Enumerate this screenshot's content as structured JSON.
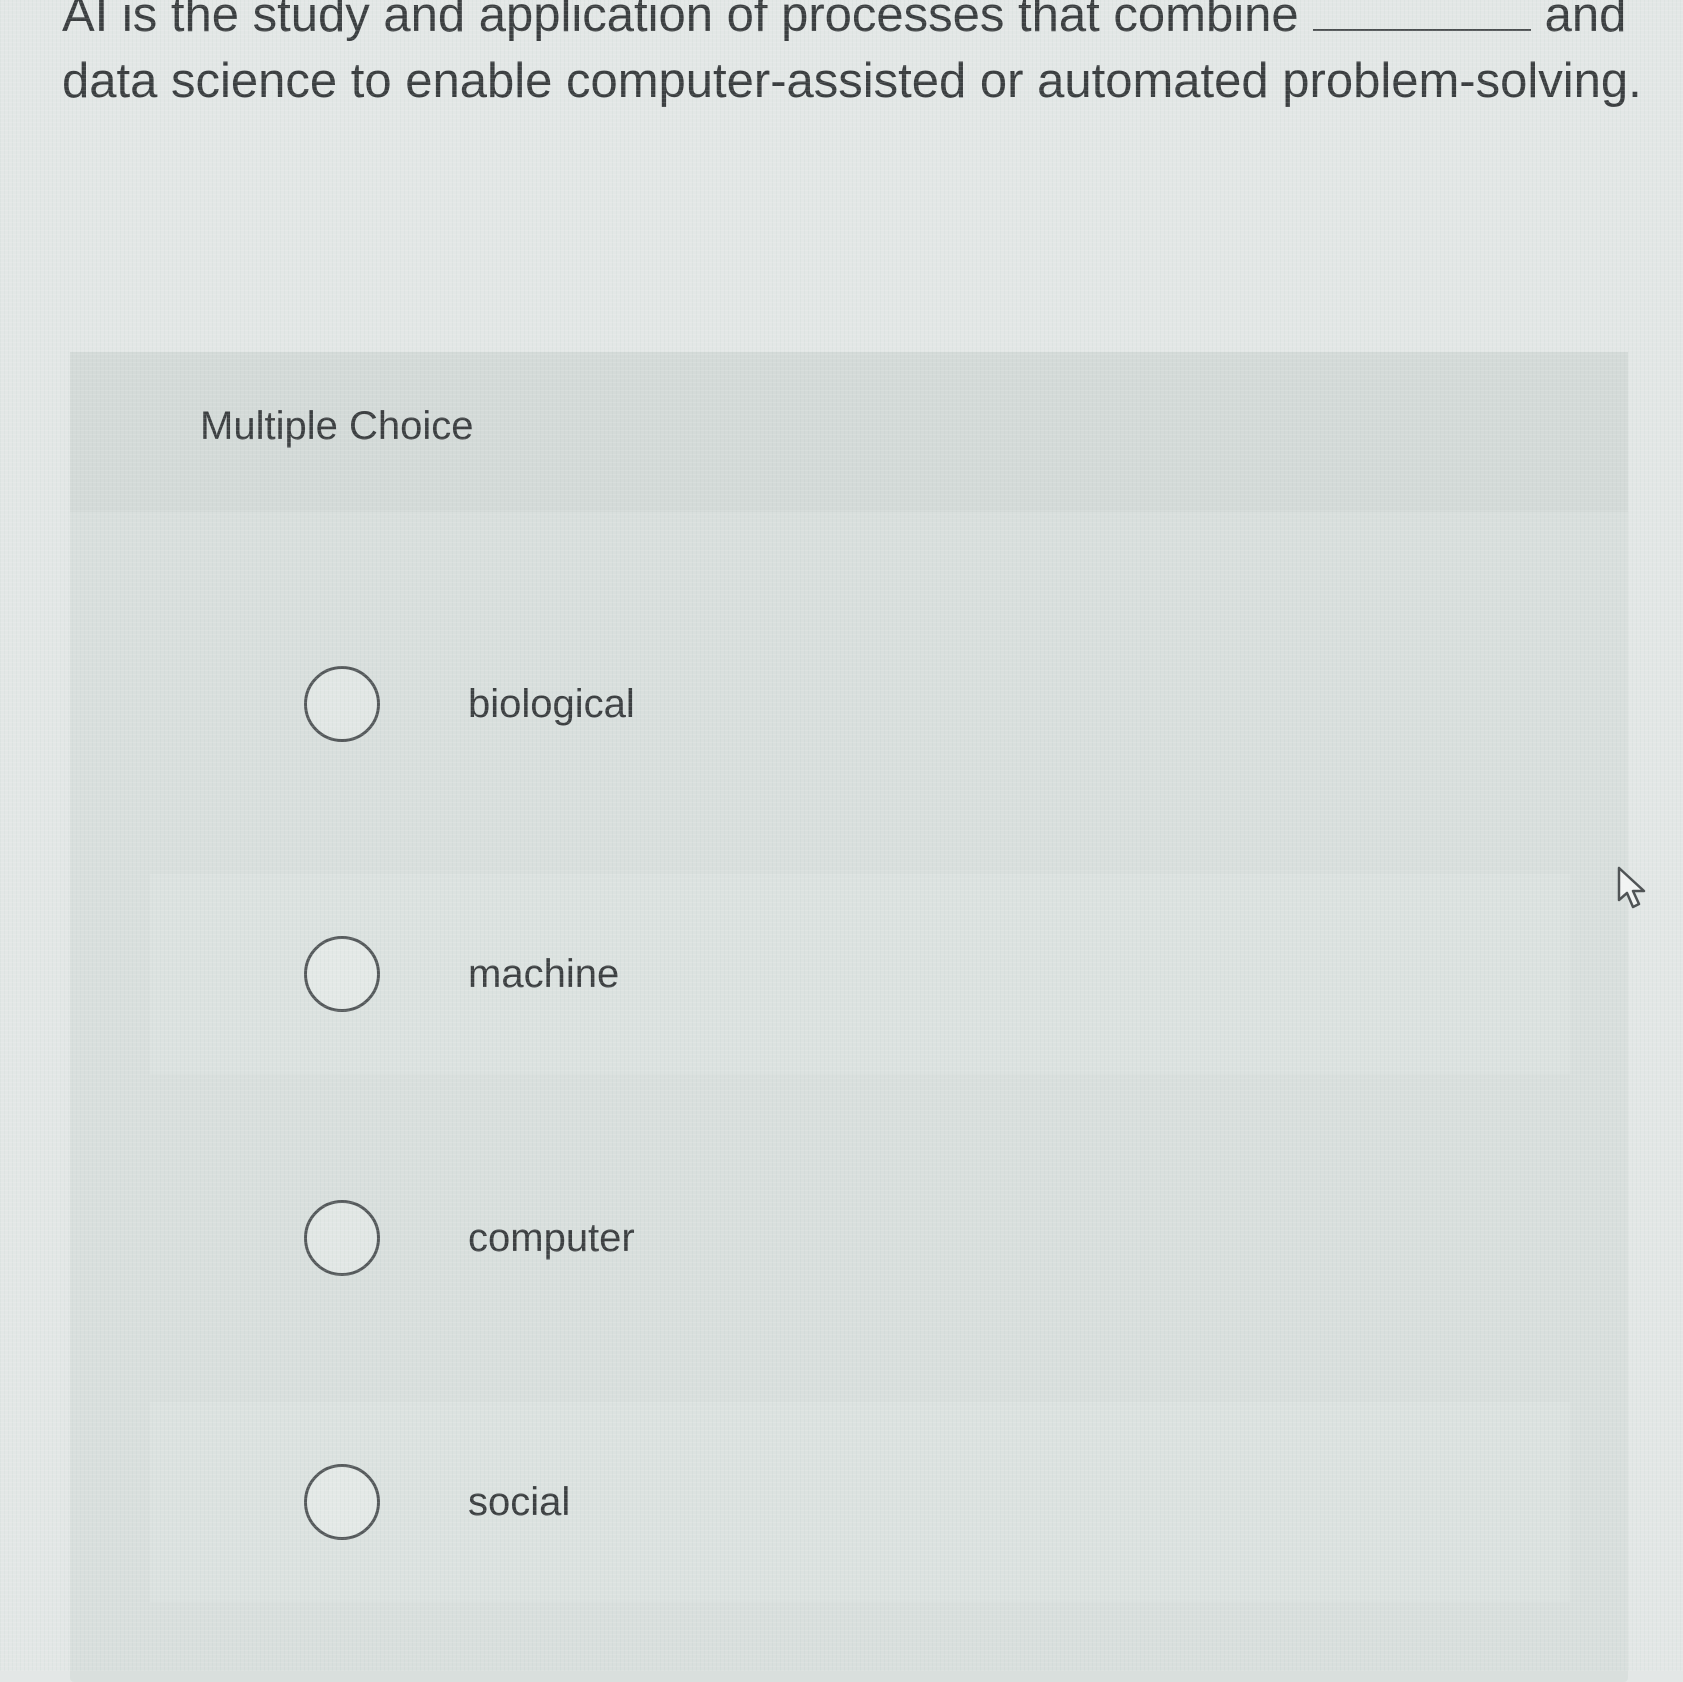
{
  "question": {
    "text_before_blank": "AI is the study and application of processes that combine",
    "text_after_blank": "and data science to enable computer-assisted or automated problem-solving."
  },
  "panel": {
    "title": "Multiple Choice"
  },
  "options": [
    {
      "label": "biological"
    },
    {
      "label": "machine"
    },
    {
      "label": "computer"
    },
    {
      "label": "social"
    }
  ],
  "icons": {
    "radio": "radio-circle-icon",
    "cursor": "mouse-pointer-icon"
  }
}
